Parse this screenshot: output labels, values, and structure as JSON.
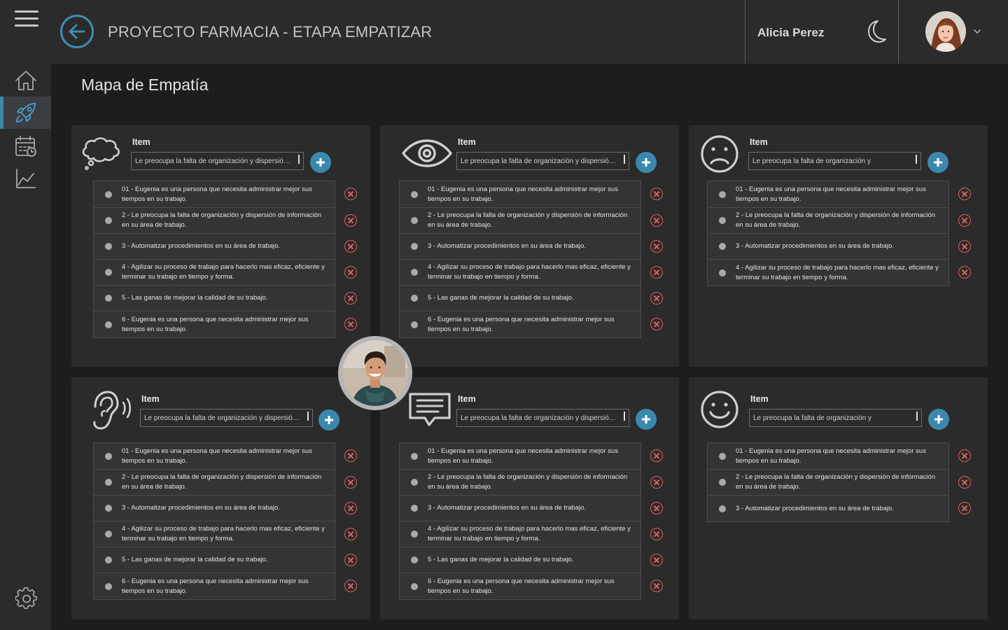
{
  "header": {
    "title": "PROYECTO FARMACIA - ETAPA EMPATIZAR",
    "user_name": "Alicia Perez"
  },
  "icons": {
    "menu": "hamburger-menu-icon",
    "back": "back-arrow-icon",
    "theme": "moon-icon",
    "user_menu": "chevron-down-icon",
    "settings": "gear-icon"
  },
  "sidebar": {
    "items": [
      {
        "name": "home",
        "icon": "home-icon"
      },
      {
        "name": "projects",
        "icon": "rocket-icon",
        "active": true
      },
      {
        "name": "dashboard",
        "icon": "calendar-chart-icon"
      },
      {
        "name": "analytics",
        "icon": "line-chart-icon"
      }
    ]
  },
  "main": {
    "section_title": "Mapa de Empatía"
  },
  "colors": {
    "accent": "#3b88ae",
    "remove": "#d9625e",
    "panel_bg": "#2b2b2b",
    "page_bg": "#1d1d1d"
  },
  "panels": [
    {
      "id": "piensa",
      "icon": "thought-cloud-icon",
      "item_label": "Item",
      "input_value": "Le preocupa la falta de organización y dispersión de...",
      "items": [
        "01 - Eugenia es una persona que necesita administrar mejor sus tiempos en su trabajo.",
        "2 - Le preocupa la falta de organización y dispersión de información en su área de trabajo.",
        "3 - Automatizar procedimientos en su área de trabajo.",
        "4 - Agilizar su proceso de trabajo para hacerlo mas eficaz, eficiente y terminar su trabajo en tiempo y forma.",
        "5 - Las ganas de mejorar la calidad de su trabajo.",
        "6 - Eugenia es una persona que necesita administrar mejor sus tiempos en su trabajo."
      ]
    },
    {
      "id": "ve",
      "icon": "eye-icon",
      "item_label": "Item",
      "input_value": "Le preocupa la falta de organización y dispersión de...",
      "items": [
        "01 - Eugenia es una persona que necesita administrar mejor sus tiempos en su trabajo.",
        "2 - Le preocupa la falta de organización y dispersión de información en su área de trabajo.",
        "3 - Automatizar procedimientos en su área de trabajo.",
        "4 - Agilizar su proceso de trabajo para hacerlo mas eficaz, eficiente y terminar su trabajo en tiempo y forma.",
        "5 - Las ganas de mejorar la calidad de su trabajo.",
        "6 - Eugenia es una persona que necesita administrar mejor sus tiempos en su trabajo."
      ]
    },
    {
      "id": "dolores",
      "icon": "sad-face-icon",
      "item_label": "Item",
      "input_value": "Le preocupa la falta de organización y",
      "items": [
        "01 - Eugenia es una persona que necesita administrar mejor sus tiempos en su trabajo.",
        "2 - Le preocupa la falta de organización y dispersión de información en su área de trabajo.",
        "3 - Automatizar procedimientos en su área de trabajo.",
        "4 - Agilizar su proceso de trabajo para hacerlo mas eficaz, eficiente y terminar su trabajo en tiempo y forma."
      ]
    },
    {
      "id": "oye",
      "icon": "ear-icon",
      "item_label": "Item",
      "input_value": "Le preocupa la falta de organización y dispersión de",
      "items": [
        "01 - Eugenia es una persona que necesita administrar mejor sus tiempos en su trabajo.",
        "2 - Le preocupa la falta de organización y dispersión de información en su área de trabajo.",
        "3 - Automatizar procedimientos en su área de trabajo.",
        "4 - Agilizar su proceso de trabajo para hacerlo mas eficaz, eficiente y terminar su trabajo en tiempo y forma.",
        "5 - Las ganas de mejorar la calidad de su trabajo.",
        "6 - Eugenia es una persona que necesita administrar mejor sus tiempos en su trabajo."
      ]
    },
    {
      "id": "dice",
      "icon": "speech-bubble-icon",
      "item_label": "Item",
      "input_value": "Le preocupa la falta de organización y dispersión de",
      "items": [
        "01 - Eugenia es una persona que necesita administrar mejor sus tiempos en su trabajo.",
        "2 - Le preocupa la falta de organización y dispersión de información en su área de trabajo.",
        "3 - Automatizar procedimientos en su área de trabajo.",
        "4 - Agilizar su proceso de trabajo para hacerlo mas eficaz, eficiente y terminar su trabajo en tiempo y forma.",
        "5 - Las ganas de mejorar la calidad de su trabajo.",
        "6 - Eugenia es una persona que necesita administrar mejor sus tiempos en su trabajo."
      ]
    },
    {
      "id": "ganancias",
      "icon": "happy-face-icon",
      "item_label": "Item",
      "input_value": "Le preocupa la falta de organización y",
      "items": [
        "01 - Eugenia es una persona que necesita administrar mejor sus tiempos en su trabajo.",
        "2 - Le preocupa la falta de organización y dispersión de información en su área de trabajo.",
        "3 - Automatizar procedimientos en su área de trabajo."
      ]
    }
  ]
}
